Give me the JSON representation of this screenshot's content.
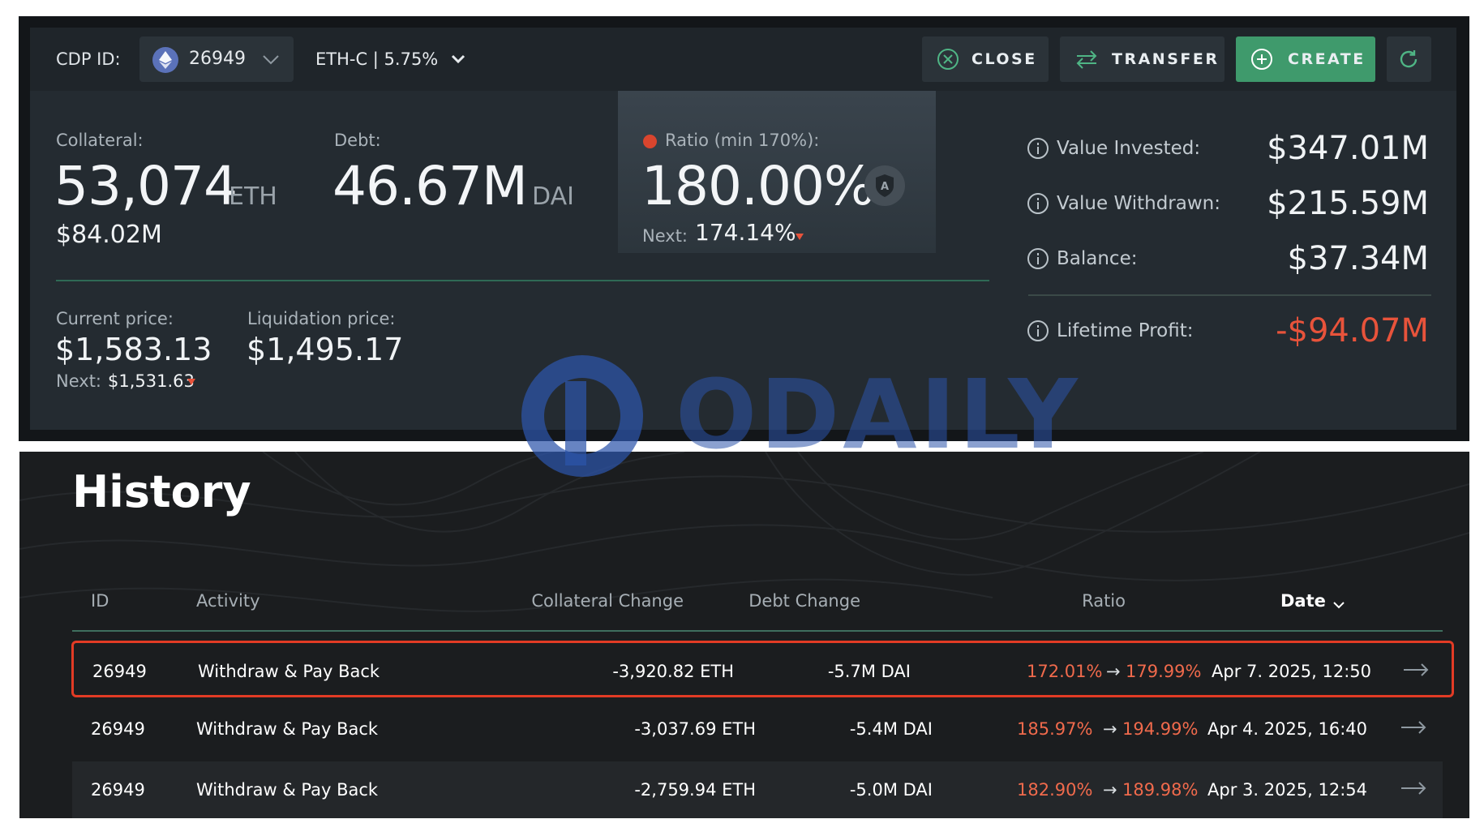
{
  "header": {
    "cdp_label": "CDP ID:",
    "cdp_value": "26949",
    "ilk": "ETH-C | 5.75%",
    "buttons": {
      "close": "CLOSE",
      "transfer": "TRANSFER",
      "create": "CREATE"
    },
    "icons": {
      "coin": "ethereum-icon",
      "close": "close-circle-icon",
      "transfer": "transfer-arrows-icon",
      "create": "plus-circle-icon",
      "refresh": "refresh-icon"
    },
    "colors": {
      "create_button": "#3f9a6c",
      "negative": "#e8533b"
    }
  },
  "collateral": {
    "label": "Collateral:",
    "amount": "53,074",
    "unit": "ETH",
    "usd": "$84.02M"
  },
  "debt": {
    "label": "Debt:",
    "amount": "46.67M",
    "unit": "DAI"
  },
  "ratio": {
    "label": "Ratio (min 170%):",
    "value": "180.00%",
    "next_label": "Next:",
    "next_value": "174.14%",
    "badge": "A"
  },
  "prices": {
    "current_label": "Current price:",
    "current_value": "$1,583.13",
    "next_label": "Next:",
    "next_value": "$1,531.63",
    "liquidation_label": "Liquidation price:",
    "liquidation_value": "$1,495.17"
  },
  "stats": {
    "invested_label": "Value Invested:",
    "invested_value": "$347.01M",
    "withdrawn_label": "Value Withdrawn:",
    "withdrawn_value": "$215.59M",
    "balance_label": "Balance:",
    "balance_value": "$37.34M",
    "profit_label": "Lifetime Profit:",
    "profit_value": "-$94.07M"
  },
  "watermark": "ODAILY",
  "history": {
    "title": "History",
    "columns": {
      "id": "ID",
      "activity": "Activity",
      "collateral": "Collateral Change",
      "debt": "Debt Change",
      "ratio": "Ratio",
      "date": "Date"
    },
    "arrow": "→",
    "rows": [
      {
        "id": "26949",
        "activity": "Withdraw & Pay Back",
        "collateral": "-3,920.82 ETH",
        "debt": "-5.7M DAI",
        "ratio_from": "172.01%",
        "ratio_to": "179.99%",
        "date": "Apr 7. 2025, 12:50"
      },
      {
        "id": "26949",
        "activity": "Withdraw & Pay Back",
        "collateral": "-3,037.69 ETH",
        "debt": "-5.4M DAI",
        "ratio_from": "185.97%",
        "ratio_to": "194.99%",
        "date": "Apr 4. 2025, 16:40"
      },
      {
        "id": "26949",
        "activity": "Withdraw & Pay Back",
        "collateral": "-2,759.94 ETH",
        "debt": "-5.0M DAI",
        "ratio_from": "182.90%",
        "ratio_to": "189.98%",
        "date": "Apr 3. 2025, 12:54"
      }
    ]
  }
}
